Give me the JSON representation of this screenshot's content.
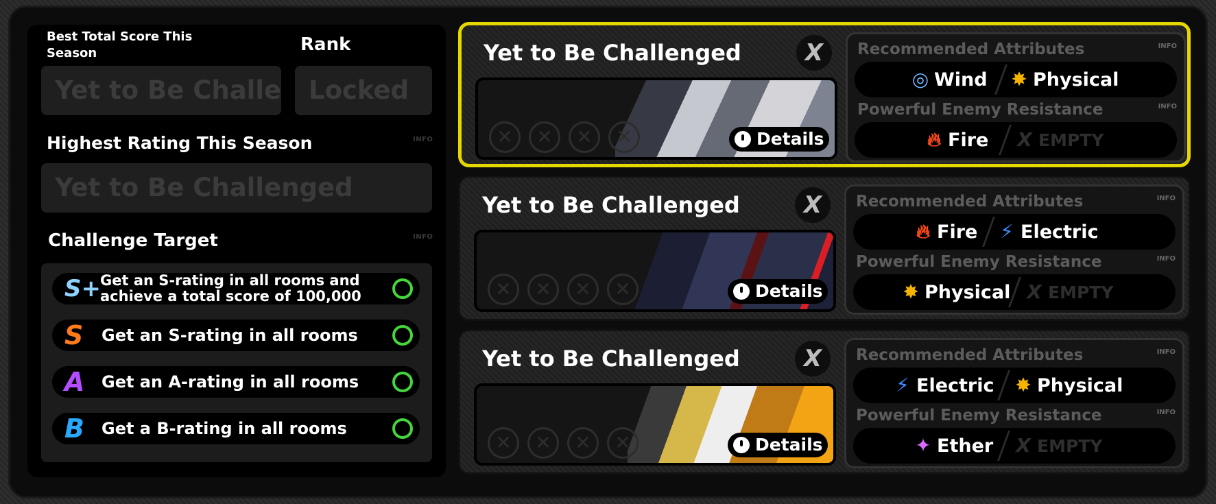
{
  "left_panel": {
    "best_score_label": "Best Total Score This Season",
    "best_score_value": "Yet to Be Challenged",
    "rank_label": "Rank",
    "rank_value": "Locked",
    "highest_rating_label": "Highest Rating This Season",
    "highest_rating_value": "Yet to Be Challenged",
    "info_label": "INFO",
    "challenge_target_label": "Challenge Target",
    "targets": [
      {
        "grade": "S+",
        "text_line1": "Get an S-rating in all rooms and",
        "text_line2": "achieve a total score of 100,000",
        "grade_color": "#8fd2ff"
      },
      {
        "grade": "S",
        "text": "Get an S-rating in all rooms",
        "grade_color": "#ff7a1a"
      },
      {
        "grade": "A",
        "text": "Get an A-rating in all rooms",
        "grade_color": "#b44dff"
      },
      {
        "grade": "B",
        "text": "Get a B-rating in all rooms",
        "grade_color": "#2aa7ff"
      }
    ]
  },
  "rooms": [
    {
      "title": "Yet to Be Challenged",
      "close_label": "X",
      "details_label": "Details",
      "recommended_label": "Recommended Attributes",
      "resistance_label": "Powerful Enemy Resistance",
      "info_label": "INFO",
      "recommended": [
        {
          "name": "Wind",
          "icon": "wind-icon",
          "color": "#6fb6ff"
        },
        {
          "name": "Physical",
          "icon": "physical-icon",
          "color": "#f5b400"
        }
      ],
      "resistance": [
        {
          "name": "Fire",
          "icon": "fire-icon",
          "color": "#ff4a1a"
        },
        {
          "name": "EMPTY",
          "icon": "empty-icon",
          "color": "#2e2e2e"
        }
      ]
    },
    {
      "title": "Yet to Be Challenged",
      "close_label": "X",
      "details_label": "Details",
      "recommended_label": "Recommended Attributes",
      "resistance_label": "Powerful Enemy Resistance",
      "info_label": "INFO",
      "recommended": [
        {
          "name": "Fire",
          "icon": "fire-icon",
          "color": "#ff4a1a"
        },
        {
          "name": "Electric",
          "icon": "electric-icon",
          "color": "#3a8cff"
        }
      ],
      "resistance": [
        {
          "name": "Physical",
          "icon": "physical-icon",
          "color": "#f5b400"
        },
        {
          "name": "EMPTY",
          "icon": "empty-icon",
          "color": "#2e2e2e"
        }
      ]
    },
    {
      "title": "Yet to Be Challenged",
      "close_label": "X",
      "details_label": "Details",
      "recommended_label": "Recommended Attributes",
      "resistance_label": "Powerful Enemy Resistance",
      "info_label": "INFO",
      "recommended": [
        {
          "name": "Electric",
          "icon": "electric-icon",
          "color": "#3a8cff"
        },
        {
          "name": "Physical",
          "icon": "physical-icon",
          "color": "#f5b400"
        }
      ],
      "resistance": [
        {
          "name": "Ether",
          "icon": "ether-icon",
          "color": "#d86bff"
        },
        {
          "name": "EMPTY",
          "icon": "empty-icon",
          "color": "#2e2e2e"
        }
      ]
    }
  ],
  "colors": {
    "selected_border": "#e5d800",
    "check_ring": "#44d63a"
  }
}
